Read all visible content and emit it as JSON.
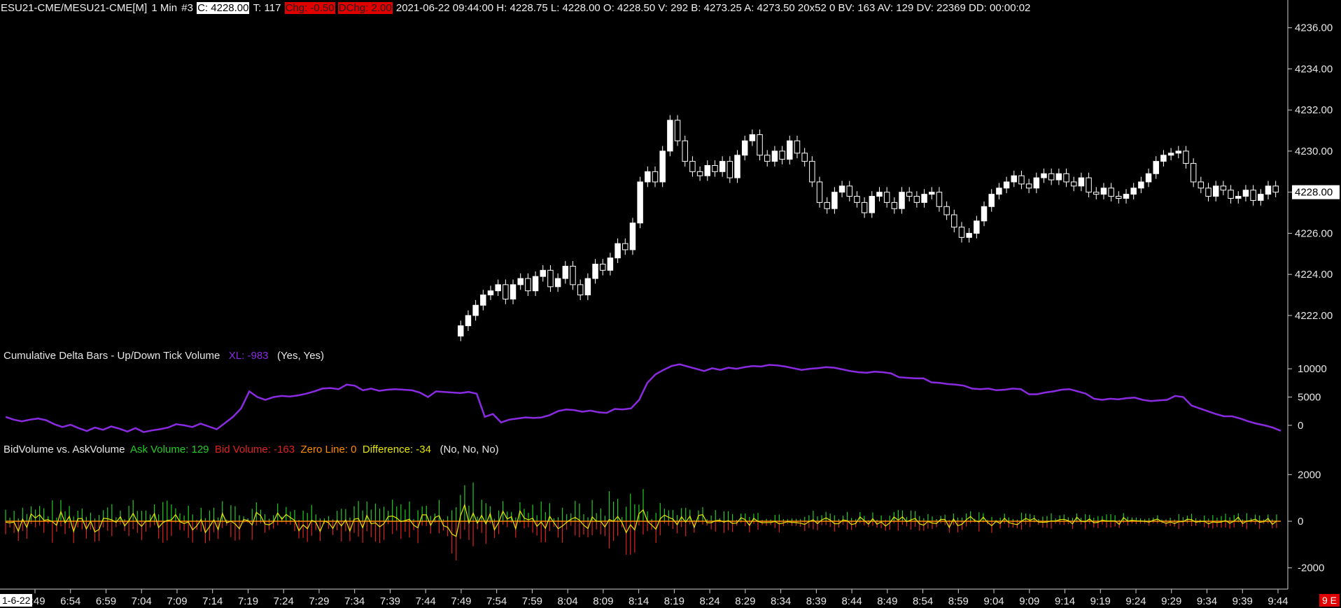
{
  "header": {
    "symbol": "ESU21-CME/MESU21-CME[M]",
    "interval": "1 Min",
    "chart_no": "#3",
    "close": "C: 4228.00",
    "ticks": "T: 117",
    "chg": "Chg: -0.50",
    "dchg": "DChg: 2.00",
    "rest": "2021-06-22 09:44:00 H: 4228.75 L: 4228.00 O: 4228.50 V: 292 B: 4273.25 A: 4273.50 20x52 0 BV: 163 AV: 129 DV: 22369 DD: 00:00:02"
  },
  "study1": {
    "name": "Cumulative Delta Bars - Up/Down Tick Volume",
    "value": "XL: -983",
    "flags": "(Yes, Yes)",
    "color": "#8a2be2"
  },
  "study2": {
    "name": "BidVolume vs. AskVolume",
    "ask": "Ask Volume: 129",
    "bid": "Bid Volume: -163",
    "zero": "Zero Line: 0",
    "diff": "Difference: -34",
    "flags": "(No, No, No)",
    "ask_color": "#22cc22",
    "bid_color": "#dd2222",
    "zero_color": "#ff8c00",
    "diff_color": "#e6e600"
  },
  "date_label": "1-6-22",
  "corner_badge": "9 E",
  "chart_data": {
    "type": "candlestick",
    "price_axis": {
      "ticks": [
        "4222.00",
        "4224.00",
        "4226.00",
        "4228.00",
        "4230.00",
        "4232.00",
        "4234.00",
        "4236.00"
      ],
      "range": [
        4220.5,
        4236.5
      ],
      "current": "4228.00"
    },
    "time_axis": [
      "6:49",
      "6:54",
      "6:59",
      "7:04",
      "7:09",
      "7:14",
      "7:19",
      "7:24",
      "7:29",
      "7:34",
      "7:39",
      "7:44",
      "7:49",
      "7:54",
      "7:59",
      "8:04",
      "8:09",
      "8:14",
      "8:19",
      "8:24",
      "8:29",
      "8:34",
      "8:39",
      "8:44",
      "8:49",
      "8:54",
      "8:59",
      "9:04",
      "9:09",
      "9:14",
      "9:19",
      "9:24",
      "9:29",
      "9:34",
      "9:39",
      "9:44"
    ],
    "candles_start": "7:49",
    "candle_close": [
      4221.5,
      4222,
      4222.5,
      4223,
      4223.2,
      4223.5,
      4222.8,
      4223.5,
      4223.8,
      4223.2,
      4223.9,
      4224.2,
      4223.4,
      4223.8,
      4224.4,
      4223.5,
      4223,
      4223.8,
      4224.5,
      4224.2,
      4224.8,
      4225.5,
      4225.2,
      4226.5,
      4228.5,
      4229,
      4228.5,
      4230,
      4231.5,
      4230.5,
      4229.5,
      4229,
      4228.8,
      4229.3,
      4229,
      4229.5,
      4228.7,
      4229.8,
      4230.5,
      4230.8,
      4229.8,
      4229.5,
      4230,
      4229.6,
      4230.5,
      4229.9,
      4229.5,
      4228.5,
      4227.5,
      4227.2,
      4228,
      4228.3,
      4227.8,
      4227.5,
      4227,
      4227.8,
      4228,
      4227.5,
      4227.2,
      4228,
      4227.8,
      4227.5,
      4227.9,
      4228,
      4227.3,
      4226.9,
      4226.3,
      4225.8,
      4226,
      4226.6,
      4227.3,
      4227.9,
      4228.2,
      4228.5,
      4228.8,
      4228.4,
      4228.2,
      4228.7,
      4228.9,
      4228.6,
      4228.9,
      4228.5,
      4228.3,
      4228.7,
      4228.0,
      4227.9,
      4228.2,
      4227.8,
      4227.7,
      4227.9,
      4228.2,
      4228.5,
      4228.9,
      4229.5,
      4229.8,
      4229.9,
      4230,
      4229.4,
      4228.5,
      4228.2,
      4227.8,
      4228.3,
      4228.1,
      4227.7,
      4227.8,
      4228.1,
      4227.6,
      4227.9,
      4228.3,
      4228.0
    ],
    "cumulative_delta_axis": {
      "ticks": [
        "10000",
        "5000",
        "0"
      ],
      "range": [
        -1500,
        11500
      ]
    },
    "cumulative_delta": [
      1500,
      1000,
      700,
      1000,
      1200,
      900,
      200,
      -300,
      100,
      -500,
      -1000,
      -400,
      -800,
      -200,
      -600,
      -1100,
      -500,
      -1200,
      -900,
      -700,
      -400,
      200,
      0,
      -300,
      300,
      -200,
      -700,
      400,
      1500,
      3000,
      6000,
      5000,
      4500,
      5000,
      5200,
      5100,
      5300,
      5600,
      6000,
      6500,
      6600,
      6400,
      7200,
      7000,
      6200,
      6500,
      6100,
      6300,
      6400,
      6300,
      6200,
      5800,
      5000,
      6000,
      5900,
      5800,
      5700,
      5900,
      5600,
      1500,
      2000,
      500,
      1000,
      1200,
      1400,
      1300,
      1400,
      1800,
      2500,
      2800,
      2700,
      2400,
      2600,
      2300,
      2200,
      2900,
      2800,
      3000,
      4500,
      7500,
      9000,
      9800,
      10500,
      10800,
      10400,
      10000,
      9600,
      10100,
      9800,
      10200,
      10000,
      10300,
      10500,
      10400,
      10700,
      10600,
      10400,
      10100,
      9800,
      10000,
      10100,
      10300,
      10200,
      9900,
      9600,
      9400,
      9300,
      9500,
      9400,
      9200,
      8500,
      8400,
      8300,
      8300,
      7600,
      7500,
      7300,
      7200,
      7000,
      6500,
      6400,
      6500,
      6200,
      6300,
      6500,
      6400,
      5500,
      5500,
      5800,
      6000,
      6300,
      6400,
      6000,
      5600,
      4700,
      4500,
      4700,
      4600,
      4800,
      4900,
      4500,
      4300,
      4400,
      4500,
      5200,
      5000,
      3500,
      3000,
      2500,
      2000,
      1600,
      1600,
      1200,
      700,
      300,
      0,
      -400,
      -983
    ],
    "volume_axis": {
      "ticks": [
        "2000",
        "0",
        "-2000"
      ],
      "range": [
        -2700,
        2700
      ]
    }
  }
}
